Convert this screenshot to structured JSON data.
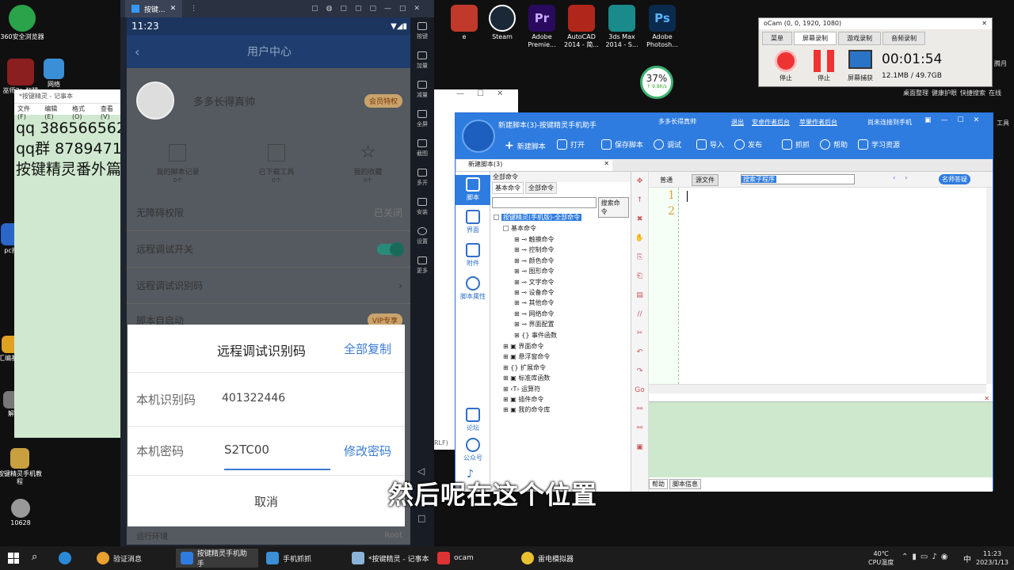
{
  "desktop": {
    "icons_left": [
      {
        "label": "360安全浏览器",
        "color": "#2aa34a"
      },
      {
        "label": "巫师3：狂猎",
        "color": "#8b1e1e"
      },
      {
        "label": "网络",
        "color": "#3a8fd6"
      },
      {
        "label": "pc按",
        "color": "#2b66c8"
      },
      {
        "label": "汇编基础",
        "color": "#e0a020"
      },
      {
        "label": "解",
        "color": "#777"
      },
      {
        "label": "按键精灵手机教程",
        "color": "#c8a040"
      },
      {
        "label": "10628",
        "color": "#999"
      }
    ],
    "icons_top": [
      {
        "label": "e",
        "color": "#c0392b"
      },
      {
        "label": "Steam",
        "color": "#1b2838"
      },
      {
        "label": "Adobe Premie...",
        "color": "#2a0a5e"
      },
      {
        "label": "AutoCAD 2014 - 简...",
        "color": "#b0261b"
      },
      {
        "label": "3ds Max 2014 - S...",
        "color": "#1a8a8a"
      },
      {
        "label": "Adobe Photosh...",
        "color": "#0a2a4e"
      }
    ],
    "right_labels": [
      "桌面整理",
      "健康护眼",
      "快捷搜索",
      "在线",
      "工具",
      "腾月"
    ],
    "speed": {
      "percent": "37%",
      "rate": "↑ 9.8K/s"
    }
  },
  "notepad": {
    "title": "*按键精灵 - 记事本",
    "menu": [
      "文件(F)",
      "编辑(E)",
      "格式(O)",
      "查看(V)"
    ],
    "lines": [
      "qq 386566562",
      "qq群 8789471",
      "按键精灵番外篇"
    ]
  },
  "emulator": {
    "tab_label": "按键...",
    "time": "11:23",
    "app_header": "用户中心",
    "username": "多多长得真帅",
    "vip_badge": "会员特权",
    "shortcuts": [
      {
        "label": "我的脚本记录",
        "count": "0个"
      },
      {
        "label": "已下载工具",
        "count": "0个"
      },
      {
        "label": "我的收藏",
        "count": "0个"
      }
    ],
    "rows": [
      {
        "label": "无障碍权限",
        "value": "已关闭"
      },
      {
        "label": "远程调试开关",
        "value": ""
      },
      {
        "label": "远程调试识别码",
        "value": ""
      },
      {
        "label": "脚本自启动",
        "value": "VIP专享"
      },
      {
        "label": "运行环境",
        "value": "Root"
      }
    ],
    "side_buttons": [
      "按键",
      "加量",
      "减量",
      "全屏",
      "截图",
      "多开",
      "安装",
      "设置",
      "更多"
    ],
    "dialog": {
      "title": "远程调试识别码",
      "copy_all": "全部复制",
      "id_label": "本机识别码",
      "id_value": "401322446",
      "pw_label": "本机密码",
      "pw_value": "S2TC00",
      "change_pw": "修改密码",
      "cancel": "取消"
    }
  },
  "ocam": {
    "title": "oCam (0, 0, 1920, 1080)",
    "tabs": [
      "菜单",
      "屏幕录制",
      "游戏录制",
      "音频录制"
    ],
    "buttons": [
      "停止",
      "停止",
      "屏幕捕获"
    ],
    "timer": "00:01:54",
    "size": "12.1MB / 49.7GB"
  },
  "ide": {
    "title": "新建脚本(3)-按键精灵手机助手",
    "user": "多多长得真帅",
    "links": [
      "退出",
      "安卓作者后台",
      "苹果作者后台"
    ],
    "connect": "尚未连接到手机",
    "toolbar": [
      "新建脚本",
      "打开",
      "保存脚本",
      "调试",
      "导入",
      "发布",
      "抓抓",
      "帮助",
      "学习资源"
    ],
    "doc_tab": "新建脚本(3)",
    "left_nav": [
      "脚本",
      "界面",
      "附件",
      "脚本属性",
      "论坛",
      "公众号"
    ],
    "panel_title": "全部命令",
    "panel_tabs": [
      "基本命令",
      "全部命令"
    ],
    "search_btn": "搜索命令",
    "tree_root": "按键精灵(手机版)-全部命令",
    "tree_l1_open": "基本命令",
    "tree_l2": [
      "触摸命令",
      "控制命令",
      "颜色命令",
      "图形命令",
      "文字命令",
      "设备命令",
      "其他命令",
      "网络命令",
      "界面配置",
      "事件函数"
    ],
    "tree_l1": [
      "界面命令",
      "悬浮窗命令",
      "扩展命令",
      "标准库函数",
      "运算符",
      "插件命令",
      "我的命令库"
    ],
    "editor_tabs": [
      "普通",
      "源文件"
    ],
    "editor_search": "搜索子程序",
    "expert_btn": "名师答疑",
    "line_numbers": [
      "1",
      "2"
    ],
    "bottom_tabs": [
      "帮助",
      "脚本信息"
    ]
  },
  "taskbar": {
    "items": [
      "验证消息",
      "按键精灵手机助手",
      "手机抓抓",
      "*按键精灵 - 记事本",
      "ocam",
      "雷电模拟器"
    ],
    "temp": "40℃",
    "temp_label": "CPU温度",
    "ime": "中",
    "time": "11:23",
    "date": "2023/1/13"
  },
  "subtitle": "然后呢在这个位置",
  "bg_window_label": "RLF)"
}
